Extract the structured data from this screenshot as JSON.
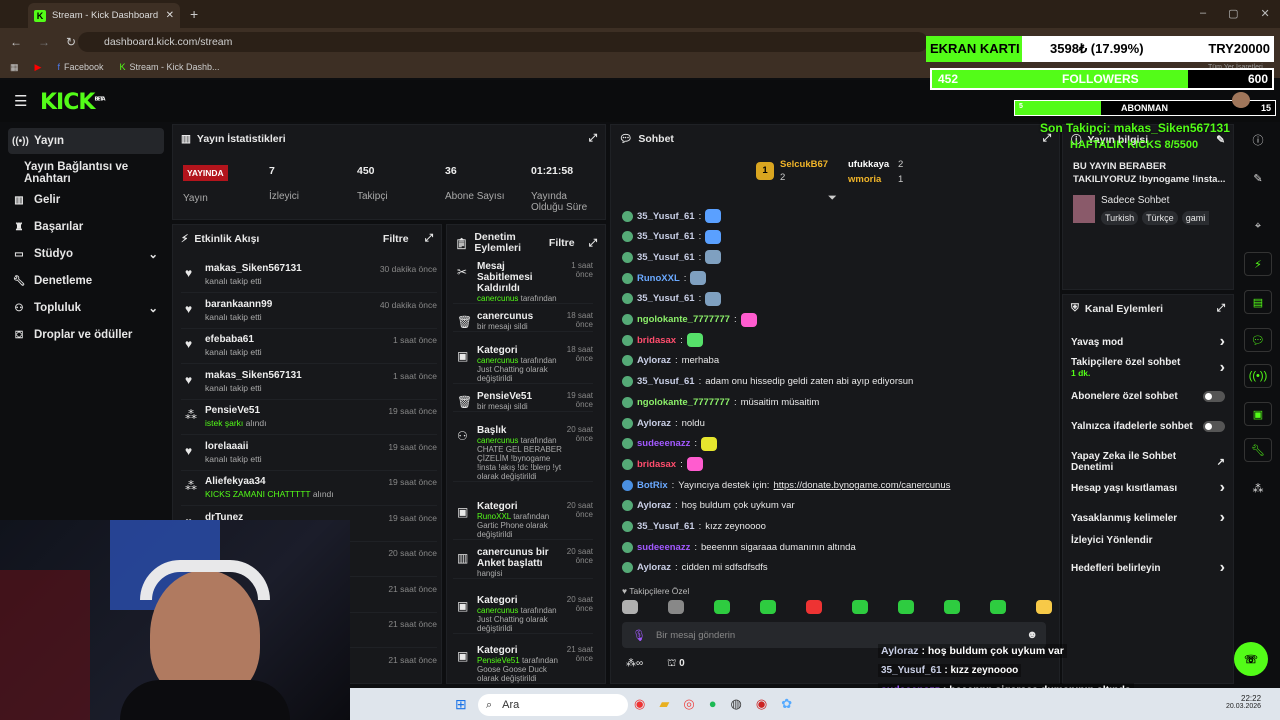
{
  "browser": {
    "tab_title": "Stream - Kick Dashboard",
    "url": "dashboard.kick.com/stream",
    "bookmarks": [
      "Facebook",
      "Stream - Kick Dashb..."
    ],
    "all_bookmarks": "Tüm Yer İşaretleri"
  },
  "app": {
    "logo": "KICK",
    "beta": "BETA"
  },
  "sidebar": {
    "items": [
      {
        "label": "Yayın",
        "icon": "broadcast-icon"
      },
      {
        "label": "Yayın Bağlantısı ve Anahtarı"
      },
      {
        "label": "Gelir",
        "icon": "chart-icon"
      },
      {
        "label": "Başarılar",
        "icon": "trophy-icon"
      },
      {
        "label": "Stüdyo",
        "icon": "studio-icon"
      },
      {
        "label": "Denetleme",
        "icon": "wrench-icon"
      },
      {
        "label": "Topluluk",
        "icon": "people-icon"
      },
      {
        "label": "Droplar ve ödüller",
        "icon": "gift-icon"
      }
    ]
  },
  "stats": {
    "title": "Yayın İstatistikleri",
    "live": "YAYINDA",
    "live_label": "Yayın",
    "viewers": "7",
    "viewers_label": "İzleyici",
    "followers": "450",
    "followers_label": "Takipçi",
    "subs": "36",
    "subs_label": "Abone Sayısı",
    "uptime": "01:21:58",
    "uptime_label": "Yayında Olduğu Süre"
  },
  "activity": {
    "title": "Etkinlik Akışı",
    "filter": "Filtre",
    "items": [
      {
        "name": "makas_Siken567131",
        "sub": "kanalı takip etti",
        "time": "30 dakika önce"
      },
      {
        "name": "barankaann99",
        "sub": "kanalı takip etti",
        "time": "40 dakika önce"
      },
      {
        "name": "efebaba61",
        "sub": "kanalı takip etti",
        "time": "1 saat önce"
      },
      {
        "name": "makas_Siken567131",
        "sub": "kanalı takip etti",
        "time": "1 saat önce"
      },
      {
        "name": "PensieVe51",
        "sub_g": "istek şarkı",
        "sub": "alındı",
        "time": "19 saat önce"
      },
      {
        "name": "lorelaaaii",
        "sub": "kanalı takip etti",
        "time": "19 saat önce"
      },
      {
        "name": "Aliefekyaa34",
        "sub_g": "KICKS ZAMANI CHATTTTT",
        "sub": "alındı",
        "time": "19 saat önce"
      },
      {
        "name": "drTunez",
        "sub": "",
        "time": "19 saat önce"
      }
    ],
    "extra_times": [
      "20 saat önce",
      "21 saat önce",
      "21 saat önce",
      "21 saat önce"
    ]
  },
  "modlog": {
    "title": "Denetim Eylemleri",
    "filter": "Filtre",
    "items": [
      {
        "name": "Mesaj Sabitlemesi Kaldırıldı",
        "sub_g": "canercunus",
        "sub": "tarafından",
        "time": "1 saat önce"
      },
      {
        "name": "canercunus",
        "sub": "bir mesajı sildi",
        "time": "18 saat önce"
      },
      {
        "name": "Kategori",
        "sub_g": "canercunus",
        "sub": "tarafından Just Chatting olarak değiştirildi",
        "time": "18 saat önce"
      },
      {
        "name": "PensieVe51",
        "sub": "bir mesajı sildi",
        "time": "19 saat önce"
      },
      {
        "name": "Başlık",
        "sub_g": "canercunus",
        "sub": "tarafından CHATE GEL BERABER ÇİZELİM !bynogame !insta !akış !dc !blerp !yt olarak değiştirildi",
        "time": "20 saat önce"
      },
      {
        "name": "Kategori",
        "sub_g": "RunoXXL",
        "sub": "tarafından Gartic Phone olarak değiştirildi",
        "time": "20 saat önce"
      },
      {
        "name": "canercunus bir Anket başlattı",
        "sub": "hangisi",
        "time": "20 saat önce"
      },
      {
        "name": "Kategori",
        "sub_g": "canercunus",
        "sub": "tarafından Just Chatting olarak değiştirildi",
        "time": "20 saat önce"
      },
      {
        "name": "Kategori",
        "sub_g": "PensieVe51",
        "sub": "tarafından Goose Goose Duck olarak değiştirildi",
        "time": "21 saat önce"
      }
    ]
  },
  "chat": {
    "title": "Sohbet",
    "top": [
      {
        "name": "SelcukB67",
        "count": "2"
      },
      {
        "name": "ufukkaya",
        "count": "2"
      },
      {
        "name": "wmoria",
        "count": "1"
      }
    ],
    "messages": [
      {
        "user": "35_Yusuf_61",
        "text": ""
      },
      {
        "user": "35_Yusuf_61",
        "text": ""
      },
      {
        "user": "35_Yusuf_61",
        "text": ""
      },
      {
        "user": "RunoXXL",
        "text": ""
      },
      {
        "user": "35_Yusuf_61",
        "text": ""
      },
      {
        "user": "ngolokante_7777777",
        "text": ""
      },
      {
        "user": "bridasax",
        "text": ""
      },
      {
        "user": "Ayloraz",
        "text": "merhaba"
      },
      {
        "user": "35_Yusuf_61",
        "text": "adam onu hissedip geldi zaten abi ayıp ediyorsun"
      },
      {
        "user": "ngolokante_7777777",
        "text": "müsaitim müsaitim"
      },
      {
        "user": "Ayloraz",
        "text": "noldu"
      },
      {
        "user": "sudeeenazz",
        "text": ""
      },
      {
        "user": "bridasax",
        "text": ""
      },
      {
        "user": "BotRix",
        "text": "Yayıncıya destek için: ",
        "link": "https://donate.bynogame.com/canercunus"
      },
      {
        "user": "Ayloraz",
        "text": "hoş buldum çok uykum var"
      },
      {
        "user": "35_Yusuf_61",
        "text": "kızz zeynoooo"
      },
      {
        "user": "sudeeenazz",
        "text": "beeennn sigaraaa dumanının altında"
      },
      {
        "user": "Ayloraz",
        "text": "cidden mi sdfsdfsdfs"
      }
    ],
    "followers_only": "Takipçilere Özel",
    "placeholder": "Bir mesaj gönderin",
    "points": "0"
  },
  "info": {
    "title": "Yayın bilgisi",
    "text": "BU YAYIN BERABER TAKILIYORUZ !bynogame !insta...",
    "category": "Sadece Sohbet",
    "tags": [
      "Turkish",
      "Türkçe",
      "gami"
    ]
  },
  "channel": {
    "title": "Kanal Eylemleri",
    "items": [
      {
        "label": "Yavaş mod",
        "type": "arrow"
      },
      {
        "label": "Takipçilere özel sohbet",
        "sub": "1 dk.",
        "type": "arrow"
      },
      {
        "label": "Abonelere özel sohbet",
        "type": "toggle"
      },
      {
        "label": "Yalnızca ifadelerle sohbet",
        "type": "toggle"
      },
      {
        "label": "Yapay Zeka ile Sohbet Denetimi",
        "type": "ext"
      },
      {
        "label": "Hesap yaşı kısıtlaması",
        "type": "arrow"
      },
      {
        "label": "Yasaklanmış kelimeler",
        "type": "arrow"
      },
      {
        "label": "İzleyici Yönlendir",
        "type": "none"
      },
      {
        "label": "Hedefleri belirleyin",
        "type": "arrow"
      }
    ]
  },
  "overlay": {
    "gpu_label": "EKRAN KARTI",
    "gpu_value": "3598₺ (17.99%)",
    "gpu_goal": "TRY20000",
    "followers_current": "452",
    "followers_label": "FOLLOWERS",
    "followers_goal": "600",
    "followers_progress": 0.753,
    "subs_current": "5",
    "subs_label": "ABONMAN",
    "subs_goal": "15",
    "last_follower": "Son Takipçi: makas_Siken567131",
    "weekly": "HAFTALIK KICKS 8/5500",
    "chat": [
      {
        "user": "Ayloraz",
        "text": "hoş buldum çok uykum var"
      },
      {
        "user": "35_Yusuf_61",
        "text": "kızz zeynoooo"
      },
      {
        "user": "sudeeenazz",
        "text": "beeennn sigaraaa dumanının altında"
      },
      {
        "user": "Ayloraz",
        "text": "cidden mi sdfsdfsdfs"
      }
    ]
  },
  "taskbar": {
    "search": "Ara",
    "time": "22:22",
    "date": "20.03.2026"
  }
}
